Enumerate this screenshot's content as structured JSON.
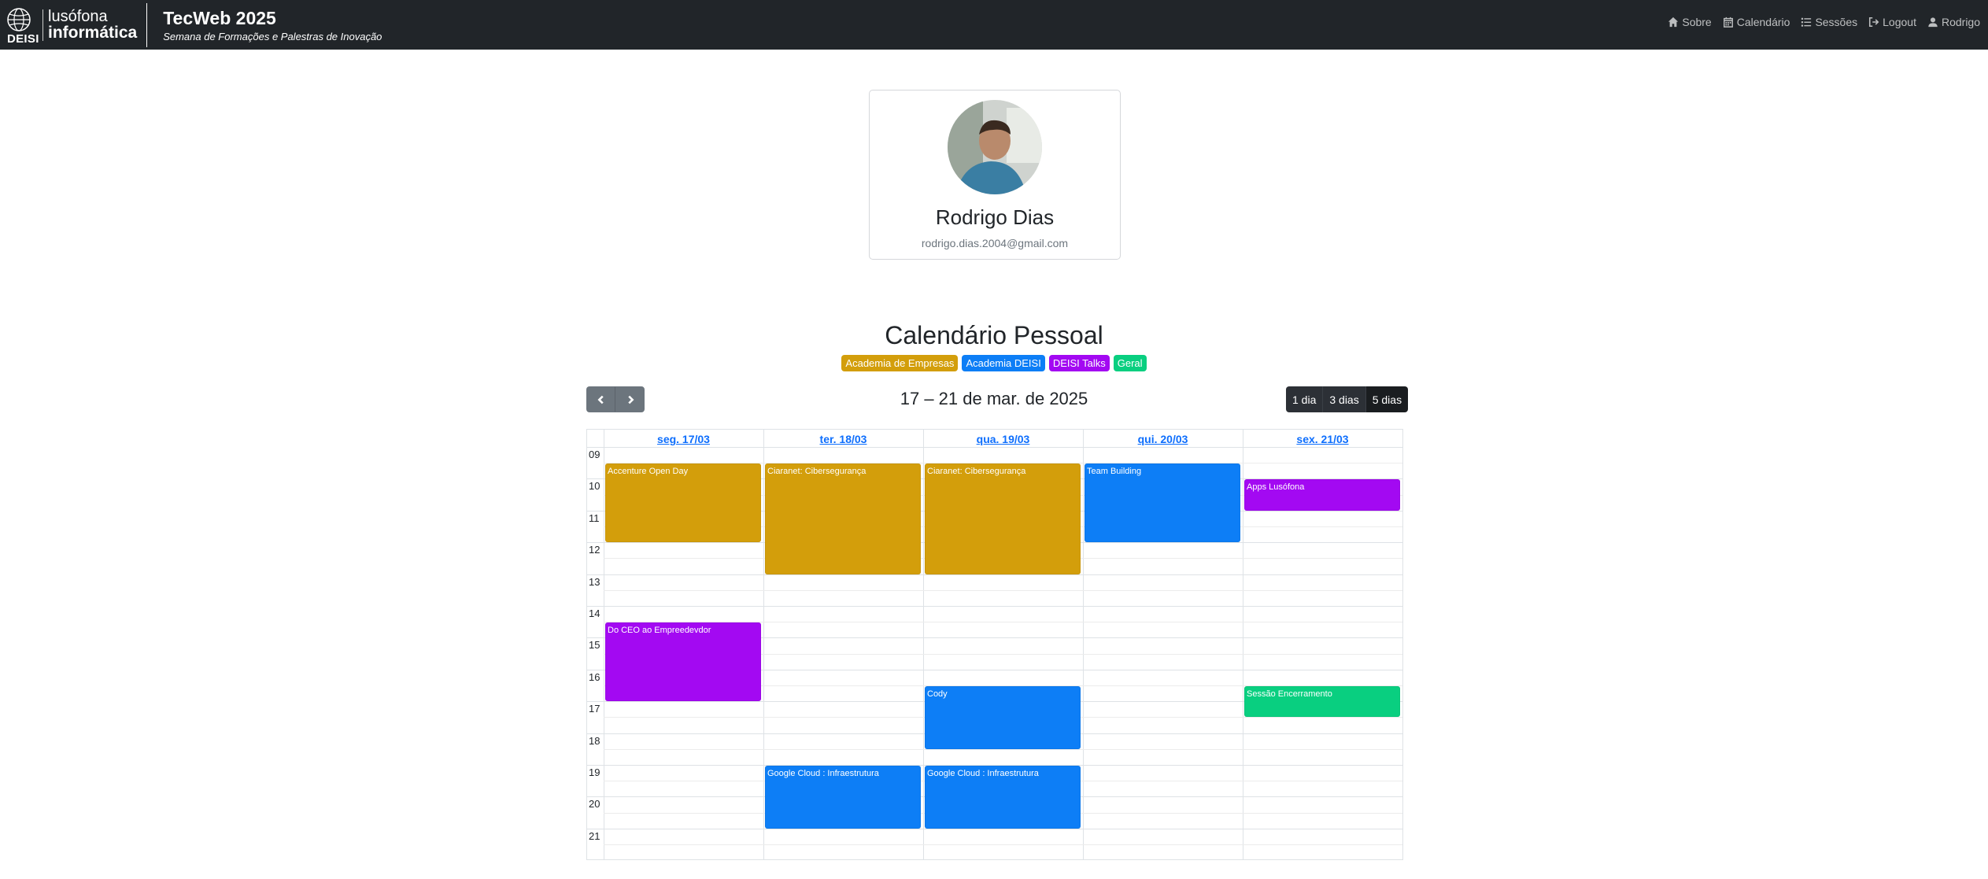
{
  "brand": {
    "deisi": "DEISI",
    "line1": "lusófona",
    "line2": "informática"
  },
  "site": {
    "title": "TecWeb 2025",
    "subtitle": "Semana de Formações e Palestras de Inovação"
  },
  "nav": [
    {
      "icon": "home-icon",
      "label": "Sobre"
    },
    {
      "icon": "calendar-icon",
      "label": "Calendário"
    },
    {
      "icon": "list-icon",
      "label": "Sessões"
    },
    {
      "icon": "logout-icon",
      "label": "Logout"
    },
    {
      "icon": "user-icon",
      "label": "Rodrigo"
    }
  ],
  "profile": {
    "name": "Rodrigo Dias",
    "email": "rodrigo.dias.2004@gmail.com"
  },
  "calendar": {
    "title": "Calendário Pessoal",
    "legend": [
      {
        "label": "Academia de Empresas",
        "color": "#d39e0b"
      },
      {
        "label": "Academia DEISI",
        "color": "#0d7ef6"
      },
      {
        "label": "DEISI Talks",
        "color": "#a309f2"
      },
      {
        "label": "Geral",
        "color": "#09cf80"
      }
    ],
    "range": "17 – 21 de mar. de 2025",
    "views": [
      "1 dia",
      "3 dias",
      "5 dias"
    ],
    "days": [
      "seg. 17/03",
      "ter. 18/03",
      "qua. 19/03",
      "qui. 20/03",
      "sex. 21/03"
    ],
    "hours": [
      "09",
      "10",
      "11",
      "12",
      "13",
      "14",
      "15",
      "16",
      "17",
      "18",
      "19",
      "20",
      "21"
    ],
    "events": [
      {
        "title": "Accenture Open Day",
        "day": 0,
        "start": 9.5,
        "end": 12.0,
        "color": "#d39e0b"
      },
      {
        "title": "Ciaranet: Cibersegurança",
        "day": 1,
        "start": 9.5,
        "end": 13.0,
        "color": "#d39e0b"
      },
      {
        "title": "Ciaranet: Cibersegurança",
        "day": 2,
        "start": 9.5,
        "end": 13.0,
        "color": "#d39e0b"
      },
      {
        "title": "Team Building",
        "day": 3,
        "start": 9.5,
        "end": 12.0,
        "color": "#0d7ef6"
      },
      {
        "title": "Apps Lusófona",
        "day": 4,
        "start": 10.0,
        "end": 11.0,
        "color": "#a309f2"
      },
      {
        "title": "Do CEO ao Empreedevdor",
        "day": 0,
        "start": 14.5,
        "end": 17.0,
        "color": "#a309f2"
      },
      {
        "title": "Cody",
        "day": 2,
        "start": 16.5,
        "end": 18.5,
        "color": "#0d7ef6"
      },
      {
        "title": "Sessão Encerramento",
        "day": 4,
        "start": 16.5,
        "end": 17.5,
        "color": "#09cf80"
      },
      {
        "title": "Google Cloud : Infraestrutura",
        "day": 1,
        "start": 19.0,
        "end": 21.0,
        "color": "#0d7ef6"
      },
      {
        "title": "Google Cloud : Infraestrutura",
        "day": 2,
        "start": 19.0,
        "end": 21.0,
        "color": "#0d7ef6"
      }
    ]
  }
}
